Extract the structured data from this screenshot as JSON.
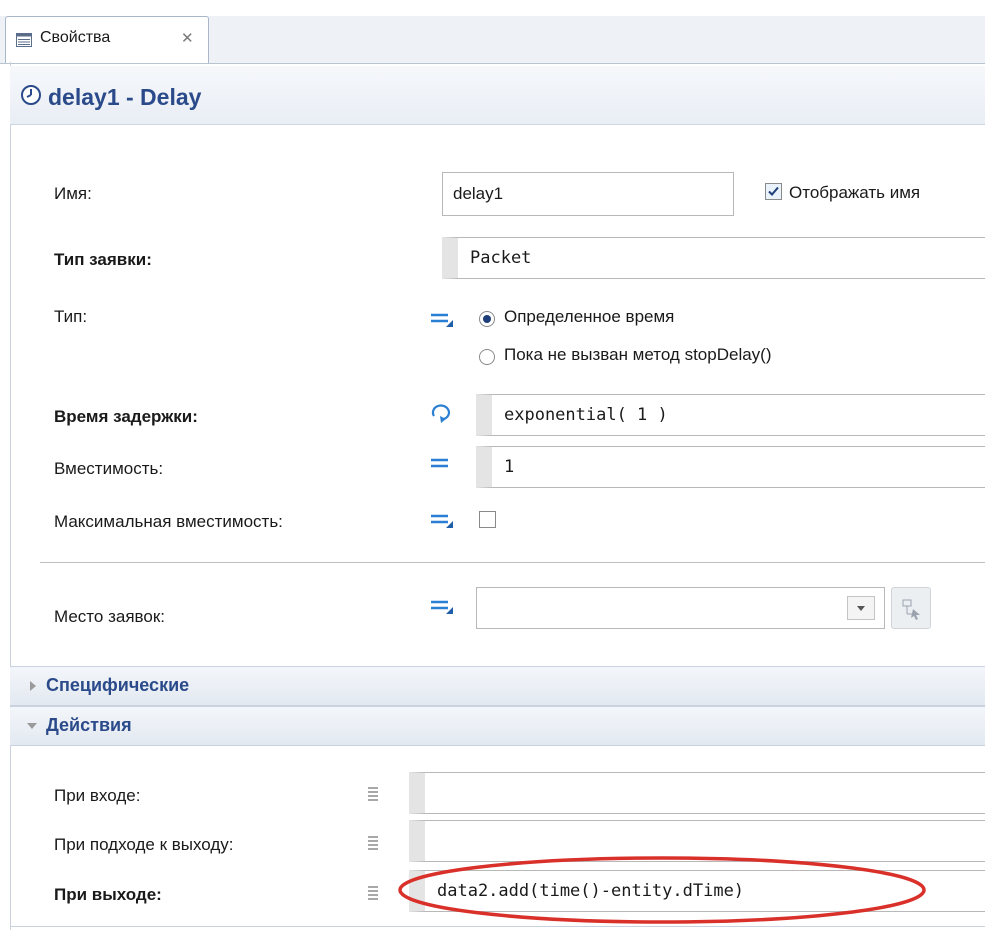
{
  "tab": {
    "label": "Свойства",
    "close": "✕",
    "icon": "properties-table-icon"
  },
  "header": {
    "title": "delay1 - Delay",
    "icon": "clock-icon"
  },
  "fields": {
    "name": {
      "label": "Имя:",
      "value": "delay1",
      "show_name_label": "Отображать имя",
      "show_name_checked": true
    },
    "entity_type": {
      "label": "Тип заявки:",
      "value": "Packet"
    },
    "type": {
      "label": "Тип:",
      "options": [
        "Определенное время",
        "Пока не вызван метод stopDelay()"
      ],
      "selected": 0
    },
    "delay_time": {
      "label": "Время задержки:",
      "value": "exponential( 1 )"
    },
    "capacity": {
      "label": "Вместимость:",
      "value": "1"
    },
    "max_capacity": {
      "label": "Максимальная вместимость:",
      "checked": false
    },
    "location": {
      "label": "Место заявок:",
      "value": ""
    }
  },
  "sections": {
    "specific": {
      "title": "Специфические",
      "expanded": false
    },
    "actions": {
      "title": "Действия",
      "expanded": true
    }
  },
  "actions": {
    "on_enter": {
      "label": "При входе:",
      "value": ""
    },
    "on_at_exit": {
      "label": "При подходе к выходу:",
      "value": ""
    },
    "on_exit": {
      "label": "При выходе:",
      "value": "data2.add(time()-entity.dTime)"
    }
  },
  "colors": {
    "accent": "#2a4a8a",
    "highlight": "#d9302a"
  }
}
